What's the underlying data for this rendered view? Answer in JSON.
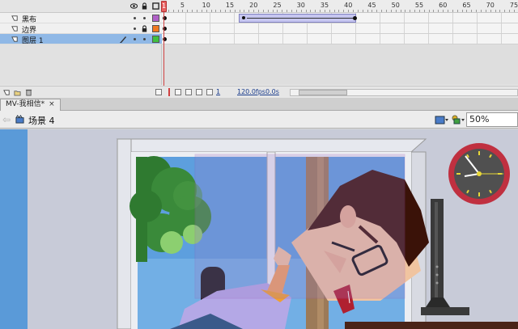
{
  "timeline": {
    "ruler_labels": [
      "1",
      "5",
      "10",
      "15",
      "20",
      "25",
      "30",
      "35",
      "40",
      "45",
      "50",
      "55",
      "60",
      "65",
      "70",
      "75"
    ],
    "current_frame": "1",
    "layers": [
      {
        "name": "黑布",
        "color": "#b060c8",
        "active": false
      },
      {
        "name": "边界",
        "color": "#f07820",
        "active": false
      },
      {
        "name": "图层 1",
        "color": "#40c040",
        "active": true
      }
    ],
    "status": {
      "frame": "1",
      "fps": "120.0fps",
      "time": "0.0s"
    }
  },
  "document": {
    "tab_title": "MV-我相信*",
    "close_glyph": "×"
  },
  "edit_bar": {
    "scene_label": "场景 4",
    "zoom": "50%"
  },
  "colors": {
    "stage_bg": "#c8cbd8",
    "wall_left": "#5a9ad8",
    "sky": "#5d9fde",
    "clock_rim": "#c03040",
    "hair": "#3a1208",
    "skin": "#f0c4a0",
    "shirt": "#b4a8e6",
    "tree": "#3a8a3a"
  }
}
